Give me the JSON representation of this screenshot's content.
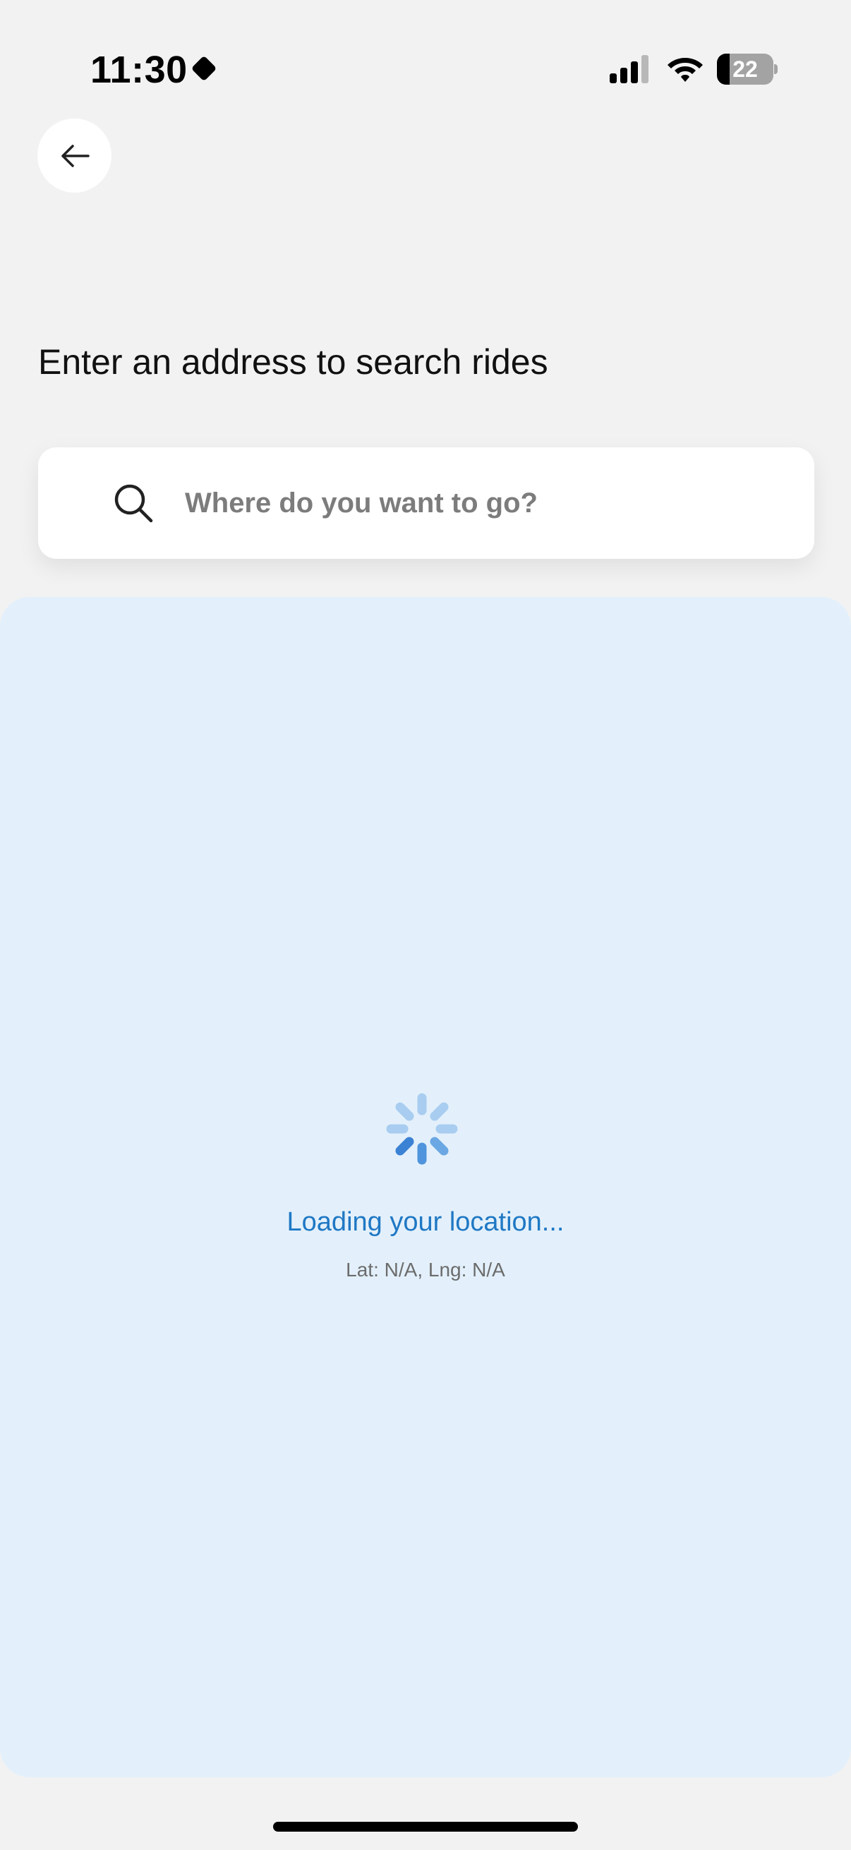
{
  "status_bar": {
    "time": "11:30",
    "battery_level": "22",
    "battery_fraction": 0.22
  },
  "back_button": {
    "icon": "arrow-left-icon"
  },
  "page": {
    "title": "Enter an address to search rides"
  },
  "search": {
    "icon": "search-icon",
    "placeholder": "Where do you want to go?",
    "value": ""
  },
  "map": {
    "loading_text": "Loading your location...",
    "coordinates_text": "Lat: N/A, Lng: N/A"
  },
  "colors": {
    "background": "#f2f2f2",
    "map_panel": "#e3f0fb",
    "loading_text": "#1f78c4",
    "spinner_active": "#3b82d4",
    "spinner_inactive": "#a8cdf0"
  }
}
